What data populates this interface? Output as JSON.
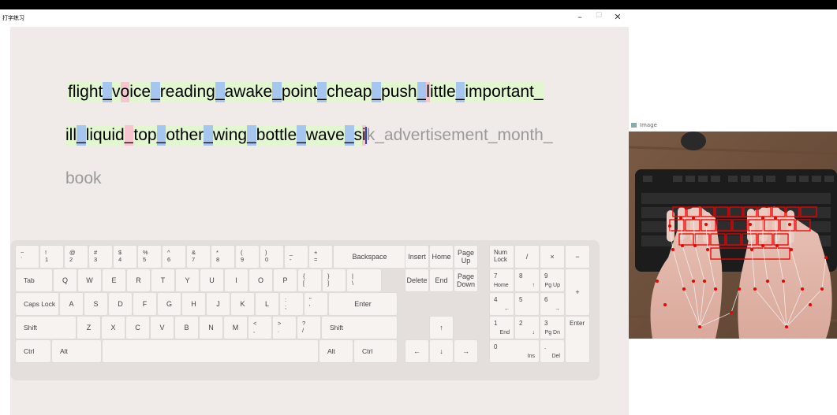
{
  "window": {
    "title": "打字练习",
    "minimize_icon": "minimize-icon",
    "maximize_icon": "maximize-icon",
    "close_icon": "close-icon",
    "minimize_glyph": "–",
    "maximize_glyph": "☐",
    "close_glyph": "✕"
  },
  "typing": {
    "line1": [
      [
        "flight",
        "t"
      ],
      [
        "_",
        "u"
      ],
      [
        "v",
        "t"
      ],
      [
        "o",
        "e"
      ],
      [
        "ice",
        "t"
      ],
      [
        "_",
        "u"
      ],
      [
        "reading",
        "t"
      ],
      [
        "_",
        "u"
      ],
      [
        "awake",
        "t"
      ],
      [
        "_",
        "u"
      ],
      [
        "point",
        "t"
      ],
      [
        "_",
        "u"
      ],
      [
        "cheap",
        "t"
      ],
      [
        "_",
        "u"
      ],
      [
        "push",
        "t"
      ],
      [
        "_",
        "u"
      ],
      [
        "l",
        "e"
      ],
      [
        "ittle",
        "t"
      ],
      [
        "_",
        "u"
      ],
      [
        "important",
        "t"
      ],
      [
        "_",
        "t"
      ]
    ],
    "line2_typed": [
      [
        "ill",
        "t"
      ],
      [
        "_",
        "u"
      ],
      [
        "liquid",
        "t"
      ],
      [
        "_",
        "e"
      ],
      [
        "top",
        "t"
      ],
      [
        "_",
        "u"
      ],
      [
        "other",
        "t"
      ],
      [
        "_",
        "u"
      ],
      [
        "wing",
        "t"
      ],
      [
        "_",
        "u"
      ],
      [
        "bottle",
        "t"
      ],
      [
        "_",
        "u"
      ],
      [
        "wave",
        "t"
      ],
      [
        "_",
        "u"
      ],
      [
        "s",
        "t"
      ],
      [
        "i",
        "e"
      ]
    ],
    "line2_pending": "k_advertisement_month_",
    "line3_pending": "book"
  },
  "keyboard": {
    "row1": [
      {
        "top": "~",
        "bot": "`"
      },
      {
        "top": "!",
        "bot": "1"
      },
      {
        "top": "@",
        "bot": "2"
      },
      {
        "top": "#",
        "bot": "3"
      },
      {
        "top": "$",
        "bot": "4"
      },
      {
        "top": "%",
        "bot": "5"
      },
      {
        "top": "^",
        "bot": "6"
      },
      {
        "top": "&",
        "bot": "7"
      },
      {
        "top": "*",
        "bot": "8"
      },
      {
        "top": "(",
        "bot": "9"
      },
      {
        "top": ")",
        "bot": "0"
      },
      {
        "top": "_",
        "bot": "-"
      },
      {
        "top": "+",
        "bot": "="
      }
    ],
    "backspace": "Backspace",
    "tab": "Tab",
    "row2": [
      "Q",
      "W",
      "E",
      "R",
      "T",
      "Y",
      "U",
      "I",
      "O",
      "P"
    ],
    "row2_sym": [
      {
        "top": "{",
        "bot": "["
      },
      {
        "top": "}",
        "bot": "]"
      },
      {
        "top": "|",
        "bot": "\\"
      }
    ],
    "capslock": "Caps Lock",
    "row3": [
      "A",
      "S",
      "D",
      "F",
      "G",
      "H",
      "J",
      "K",
      "L"
    ],
    "row3_sym": [
      {
        "top": ":",
        "bot": ";"
      },
      {
        "top": "\"",
        "bot": "'"
      }
    ],
    "enter": "Enter",
    "shift_left": "Shift",
    "row4": [
      "Z",
      "X",
      "C",
      "V",
      "B",
      "N",
      "M"
    ],
    "row4_sym": [
      {
        "top": "<",
        "bot": ","
      },
      {
        "top": ">",
        "bot": "."
      },
      {
        "top": "?",
        "bot": "/"
      }
    ],
    "shift_right": "Shift",
    "ctrl_left": "Ctrl",
    "alt_left": "Alt",
    "alt_right": "Alt",
    "ctrl_right": "Ctrl",
    "insert": "Insert",
    "home": "Home",
    "page_up": "Page\nUp",
    "delete": "Delete",
    "end": "End",
    "page_down": "Page\nDown",
    "arrow_up": "↑",
    "arrow_left": "←",
    "arrow_down": "↓",
    "arrow_right": "→",
    "numpad": {
      "numlock": "Num\nLock",
      "slash": "/",
      "star": "×",
      "minus": "−",
      "n7": "7",
      "n7b": "Home",
      "n8": "8",
      "n8b": "↑",
      "n9": "9",
      "n9b": "Pg Up",
      "plus": "+",
      "n4": "4",
      "n4b": "←",
      "n5": "5",
      "n6": "6",
      "n6b": "→",
      "n1": "1",
      "n1b": "End",
      "n2": "2",
      "n2b": "↓",
      "n3": "3",
      "n3b": "Pg Dn",
      "enter": "Enter",
      "n0": "0",
      "n0b": "Ins",
      "dot": ".",
      "dotb": "Del"
    }
  },
  "image_window": {
    "title": "Image",
    "title_icon": "image-window-icon"
  }
}
